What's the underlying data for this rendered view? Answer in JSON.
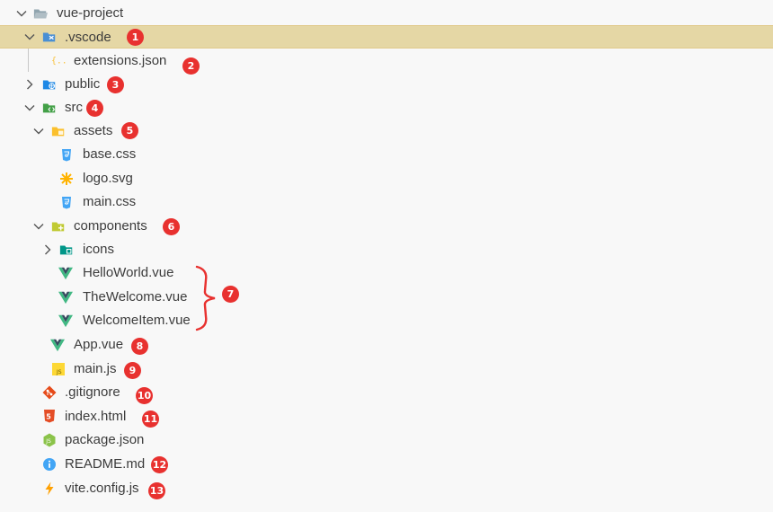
{
  "explorer": {
    "root": "vue-project",
    "items": [
      {
        "label": ".vscode",
        "icon": "vscode-folder-icon",
        "badge": "1"
      },
      {
        "label": "extensions.json",
        "icon": "json-icon",
        "badge": "2"
      },
      {
        "label": "public",
        "icon": "public-folder-icon",
        "badge": "3"
      },
      {
        "label": "src",
        "icon": "src-folder-icon",
        "badge": "4"
      },
      {
        "label": "assets",
        "icon": "assets-folder-icon",
        "badge": "5"
      },
      {
        "label": "base.css",
        "icon": "css-icon"
      },
      {
        "label": "logo.svg",
        "icon": "svg-icon"
      },
      {
        "label": "main.css",
        "icon": "css-icon"
      },
      {
        "label": "components",
        "icon": "components-folder-icon",
        "badge": "6"
      },
      {
        "label": "icons",
        "icon": "icons-folder-icon"
      },
      {
        "label": "HelloWorld.vue",
        "icon": "vue-icon"
      },
      {
        "label": "TheWelcome.vue",
        "icon": "vue-icon"
      },
      {
        "label": "WelcomeItem.vue",
        "icon": "vue-icon"
      },
      {
        "label": "App.vue",
        "icon": "vue-icon",
        "badge": "8"
      },
      {
        "label": "main.js",
        "icon": "js-icon",
        "badge": "9"
      },
      {
        "label": ".gitignore",
        "icon": "git-icon",
        "badge": "10"
      },
      {
        "label": "index.html",
        "icon": "html-icon",
        "badge": "11"
      },
      {
        "label": "package.json",
        "icon": "nodejs-icon"
      },
      {
        "label": "README.md",
        "icon": "info-icon",
        "badge": "12"
      },
      {
        "label": "vite.config.js",
        "icon": "vite-icon",
        "badge": "13"
      }
    ],
    "group_badge": "7"
  },
  "colors": {
    "selected_row": "#e5d7a5",
    "badge": "#e8312f",
    "brace": "#e8312f"
  }
}
